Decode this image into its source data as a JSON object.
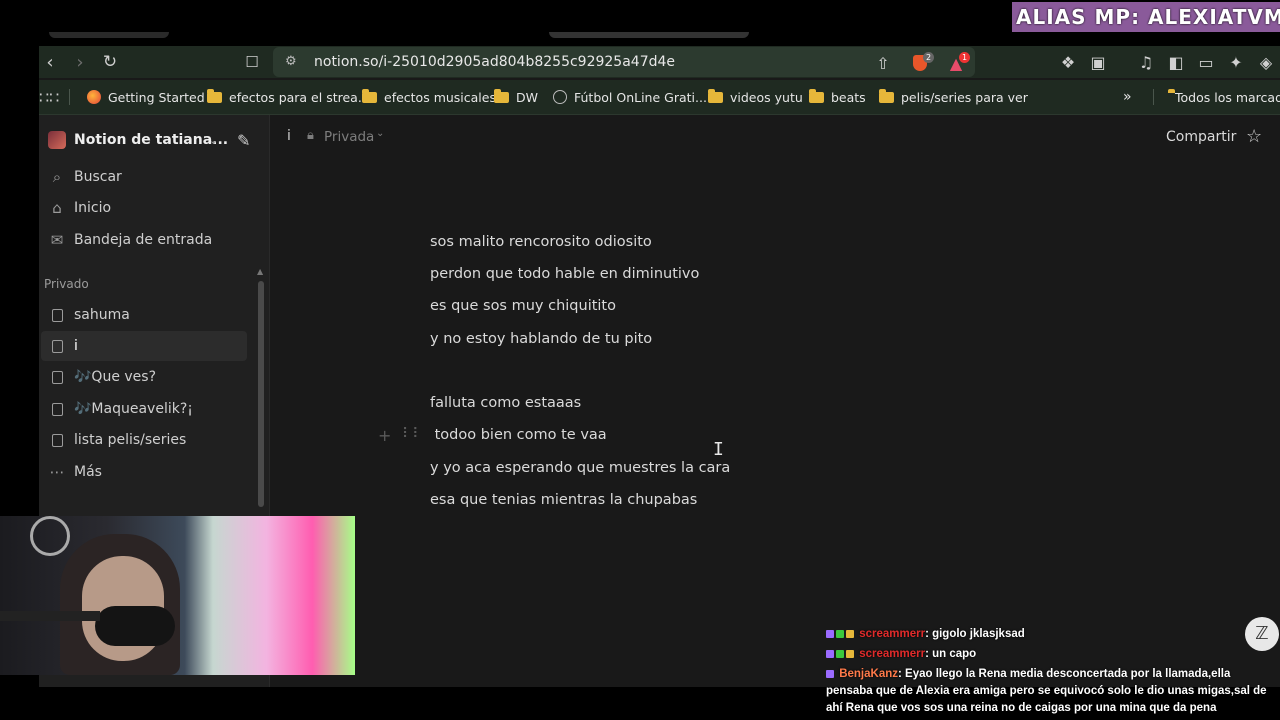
{
  "overlay": {
    "banner": "ALIAS MP: ALEXIATVM"
  },
  "browser": {
    "url": "notion.so/i-25010d2905ad804b8255c92925a47d4e",
    "brave_badge": "2",
    "alert_badge": "1",
    "bookmarks": [
      {
        "label": "Getting Started",
        "icon": "firefox-icon"
      },
      {
        "label": "efectos para el strea...",
        "icon": "folder-icon"
      },
      {
        "label": "efectos musicales",
        "icon": "folder-icon"
      },
      {
        "label": "DW",
        "icon": "folder-icon"
      },
      {
        "label": "Fútbol OnLine Grati...",
        "icon": "globe-icon"
      },
      {
        "label": "videos yutu",
        "icon": "folder-icon"
      },
      {
        "label": "beats",
        "icon": "folder-icon"
      },
      {
        "label": "pelis/series para ver",
        "icon": "folder-icon"
      }
    ],
    "more_bookmarks": "»",
    "all_bookmarks": "Todos los marcadores"
  },
  "notion": {
    "workspace": "Notion de tatiana...",
    "nav": {
      "search": "Buscar",
      "home": "Inicio",
      "inbox": "Bandeja de entrada"
    },
    "section_private": "Privado",
    "pages": [
      {
        "label": "sahuma",
        "icon": "page-icon"
      },
      {
        "label": "i",
        "icon": "page-icon",
        "active": true
      },
      {
        "label": "🎶Que ves?",
        "icon": "page-icon"
      },
      {
        "label": "🎶Maqueavelik?¡",
        "icon": "page-icon"
      },
      {
        "label": "lista pelis/series",
        "icon": "page-icon"
      }
    ],
    "more": "Más",
    "breadcrumb": {
      "title": "i",
      "privacy": "Privada"
    },
    "share": "Compartir",
    "lines": [
      "sos  malito rencorosito odiosito",
      "perdon que todo hable en diminutivo",
      "es que sos muy chiquitito",
      "y no estoy hablando de tu pito",
      "falluta como estaaas",
      " todoo bien como te vaa",
      "y yo aca esperando que muestres la cara",
      "esa que tenias mientras la chupabas"
    ]
  },
  "chat": [
    {
      "user": "screammerr",
      "text": ": gigolo jklasjksad",
      "user_color": "#e02b2b"
    },
    {
      "user": "screammerr",
      "text": ": un capo",
      "user_color": "#e02b2b"
    },
    {
      "user": "BenjaKanz",
      "text": ": Eyao llego la Rena media desconcertada por la llamada,ella pensaba que de Alexia era amiga pero se equivocó solo le dio unas migas,sal de ahí Rena que vos sos una reina no de caigas por una mina que da pena",
      "user_color": "#ff7a4a"
    }
  ]
}
